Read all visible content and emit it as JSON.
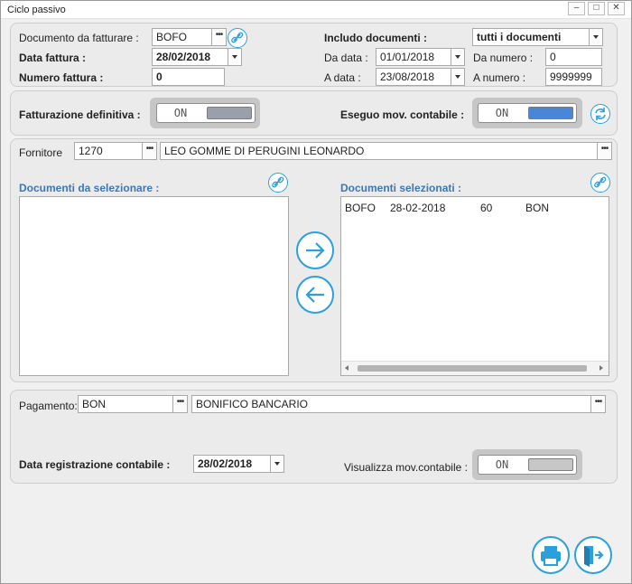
{
  "window": {
    "title": "Ciclo passivo",
    "minimize": "–",
    "maximize": "□",
    "close": "✕"
  },
  "header": {
    "documento_label": "Documento da fatturare :",
    "documento_value": "BOFO",
    "data_fattura_label": "Data fattura :",
    "data_fattura_value": "28/02/2018",
    "numero_fattura_label": "Numero fattura :",
    "numero_fattura_value": "0",
    "includo_label": "Includo documenti :",
    "includo_value": "tutti i documenti",
    "da_data_label": "Da data :",
    "da_data_value": "01/01/2018",
    "a_data_label": "A data :",
    "a_data_value": "23/08/2018",
    "da_numero_label": "Da numero :",
    "da_numero_value": "0",
    "a_numero_label": "A numero :",
    "a_numero_value": "9999999"
  },
  "toggles": {
    "fatturazione_label": "Fatturazione definitiva :",
    "fatturazione_state": "ON",
    "eseguo_label": "Eseguo mov. contabile :",
    "eseguo_state": "ON",
    "visualizza_label": "Visualizza mov.contabile :",
    "visualizza_state": "ON",
    "knob_inactive_color": "#9aa0ab",
    "knob_active_color": "#4a86d8"
  },
  "supplier": {
    "label": "Fornitore",
    "code": "1270",
    "name": "LEO GOMME DI PERUGINI LEONARDO"
  },
  "documents": {
    "available_title": "Documenti da selezionare :",
    "selected_title": "Documenti selezionati :",
    "selected_rows": [
      {
        "type": "BOFO",
        "date": "28-02-2018",
        "number": "60",
        "payment": "BON"
      }
    ]
  },
  "payment": {
    "label": "Pagamento:",
    "code": "BON",
    "description": "BONIFICO BANCARIO",
    "data_reg_label": "Data registrazione contabile :",
    "data_reg_value": "28/02/2018"
  },
  "colors": {
    "accent": "#2ba0dc",
    "heading_blue": "#3d77b4"
  },
  "icons": [
    "link-icon",
    "refresh-icon",
    "arrow-right-icon",
    "arrow-left-icon",
    "printer-icon",
    "exit-icon"
  ]
}
